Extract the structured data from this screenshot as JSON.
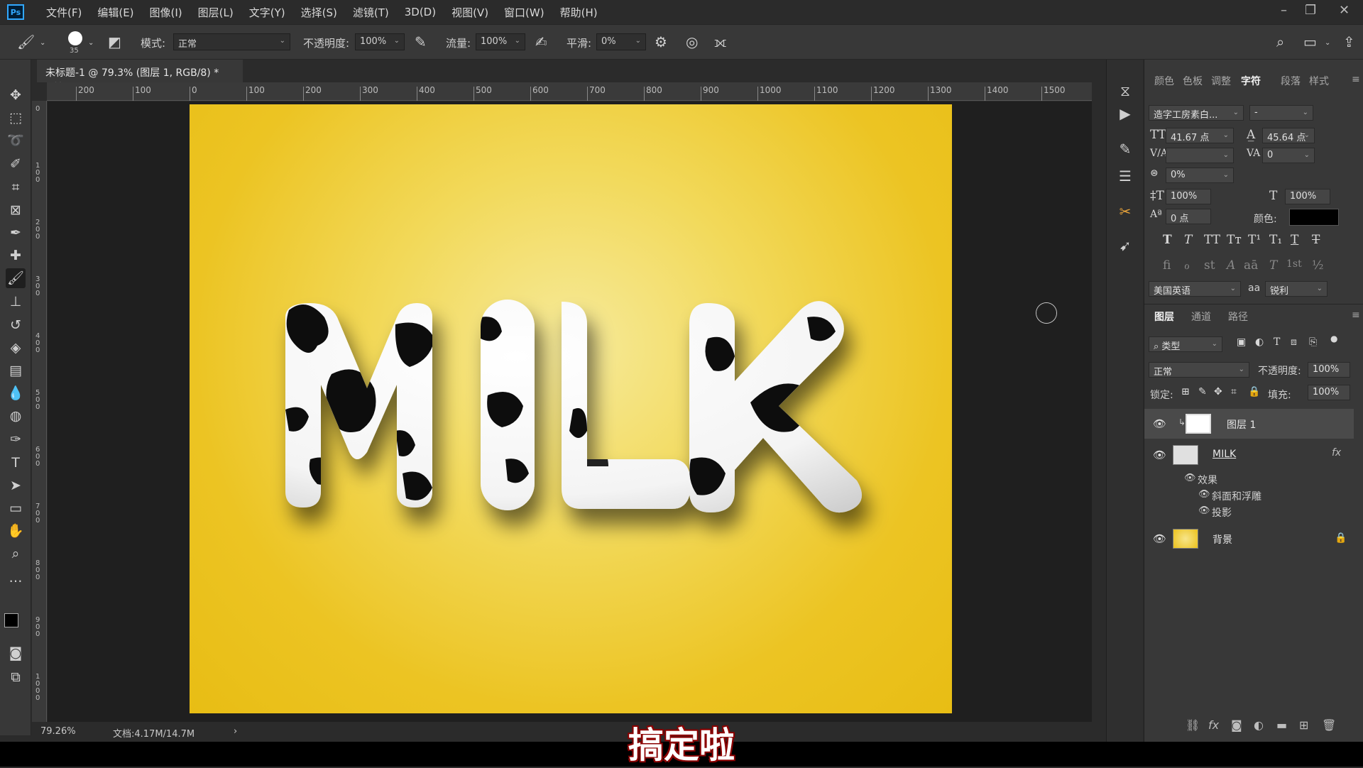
{
  "menu": {
    "logo": "Ps",
    "items": [
      "文件(F)",
      "编辑(E)",
      "图像(I)",
      "图层(L)",
      "文字(Y)",
      "选择(S)",
      "滤镜(T)",
      "3D(D)",
      "视图(V)",
      "窗口(W)",
      "帮助(H)"
    ]
  },
  "options": {
    "brush_size": "35",
    "mode_label": "模式:",
    "mode_value": "正常",
    "opacity_label": "不透明度:",
    "opacity_value": "100%",
    "flow_label": "流量:",
    "flow_value": "100%",
    "smooth_label": "平滑:",
    "smooth_value": "0%"
  },
  "document": {
    "tab_title": "未标题-1 @ 79.3% (图层 1, RGB/8) *",
    "close": "×",
    "zoom": "79.26%",
    "doc_info": "文档:4.17M/14.7M",
    "arrow": "›"
  },
  "ruler": {
    "h_labels": [
      "200",
      "100",
      "0",
      "100",
      "200",
      "300",
      "400",
      "500",
      "600",
      "700",
      "800",
      "900",
      "1000",
      "1100",
      "1200",
      "1300",
      "1400",
      "1500"
    ],
    "v_labels": [
      "0",
      "100",
      "200",
      "300",
      "400",
      "500",
      "600",
      "700",
      "800",
      "900",
      "1000"
    ]
  },
  "artwork": {
    "text": "MILK"
  },
  "subtitle": "搞定啦",
  "char_panel": {
    "tabs": [
      "颜色",
      "色板",
      "调整",
      "字符",
      "段落",
      "样式"
    ],
    "active_tab": "字符",
    "font_family": "造字工房素白...",
    "font_style": "-",
    "font_size": "41.67 点",
    "leading": "45.64 点",
    "kerning": "",
    "tracking": "0",
    "scale_pct": "0%",
    "vscale": "100%",
    "hscale": "100%",
    "baseline": "0 点",
    "color_label": "颜色:",
    "language": "美国英语",
    "aa_label": "aa",
    "antialias": "锐利",
    "style_buttons": [
      "T",
      "T",
      "TT",
      "Tт",
      "T¹",
      "T₁",
      "T",
      "T"
    ],
    "ot_buttons": [
      "fi",
      "ℴ",
      "st",
      "A",
      "aā",
      "T",
      "1st",
      "½"
    ]
  },
  "layers_panel": {
    "tabs": [
      "图层",
      "通道",
      "路径"
    ],
    "active_tab": "图层",
    "filter_label": "类型",
    "blend_mode": "正常",
    "opacity_label": "不透明度:",
    "opacity_value": "100%",
    "lock_label": "锁定:",
    "fill_label": "填充:",
    "fill_value": "100%",
    "layers": [
      {
        "name": "图层 1"
      },
      {
        "name": "MILK",
        "fx": "fx"
      },
      {
        "name": "背景"
      }
    ],
    "effects_label": "效果",
    "effects": [
      "斜面和浮雕",
      "投影"
    ]
  },
  "colors": {
    "accent": "#31a8ff",
    "canvas_yellow": "#ecc423",
    "panel_bg": "#383838",
    "subtitle_outline": "#8b0000"
  }
}
